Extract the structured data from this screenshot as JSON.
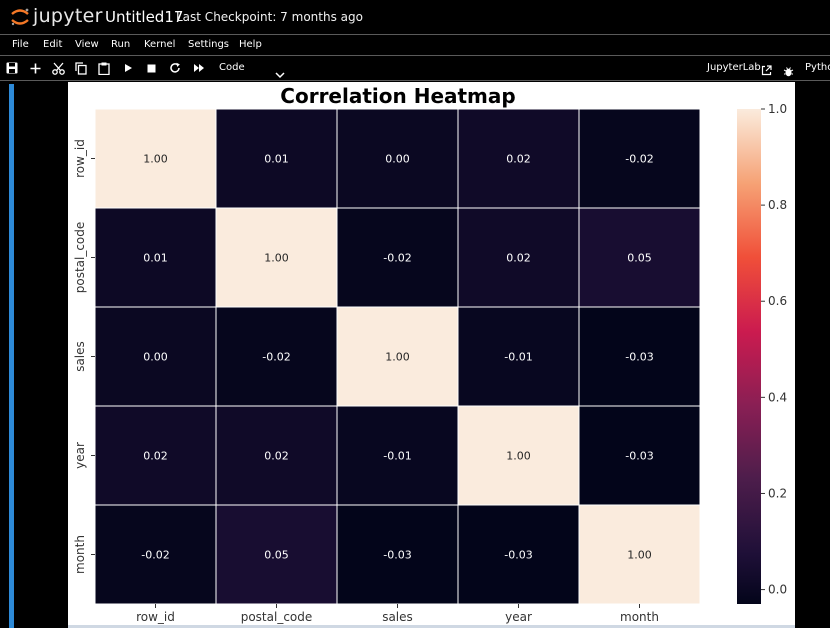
{
  "app": {
    "logo_text": "jupyter",
    "notebook_title": "Untitled17",
    "checkpoint": "Last Checkpoint: 7 months ago"
  },
  "menu": [
    "File",
    "Edit",
    "View",
    "Run",
    "Kernel",
    "Settings",
    "Help"
  ],
  "toolbar": {
    "buttons": [
      "save-icon",
      "add-icon",
      "cut-icon",
      "copy-icon",
      "paste-icon",
      "run-icon",
      "stop-icon",
      "restart-icon",
      "fast-forward-icon"
    ],
    "cell_type": "Code",
    "lab_link": "JupyterLab",
    "kernel": "Pytho"
  },
  "chart_data": {
    "type": "heatmap",
    "title": "Correlation Heatmap",
    "x_labels": [
      "row_id",
      "postal_code",
      "sales",
      "year",
      "month"
    ],
    "y_labels": [
      "row_id",
      "postal_code",
      "sales",
      "year",
      "month"
    ],
    "values": [
      [
        1.0,
        0.01,
        0.0,
        0.02,
        -0.02
      ],
      [
        0.01,
        1.0,
        -0.02,
        0.02,
        0.05
      ],
      [
        0.0,
        -0.02,
        1.0,
        -0.01,
        -0.03
      ],
      [
        0.02,
        0.02,
        -0.01,
        1.0,
        -0.03
      ],
      [
        -0.02,
        0.05,
        -0.03,
        -0.03,
        1.0
      ]
    ],
    "annotations": [
      [
        "1.00",
        "0.01",
        "0.00",
        "0.02",
        "-0.02"
      ],
      [
        "0.01",
        "1.00",
        "-0.02",
        "0.02",
        "0.05"
      ],
      [
        "0.00",
        "-0.02",
        "1.00",
        "-0.01",
        "-0.03"
      ],
      [
        "0.02",
        "0.02",
        "-0.01",
        "1.00",
        "-0.03"
      ],
      [
        "-0.02",
        "0.05",
        "-0.03",
        "-0.03",
        "1.00"
      ]
    ],
    "colorbar_ticks": [
      "1.0",
      "0.8",
      "0.6",
      "0.4",
      "0.2",
      "0.0"
    ],
    "colorbar_range": [
      -0.03,
      1.0
    ],
    "colormap": "rocket"
  }
}
